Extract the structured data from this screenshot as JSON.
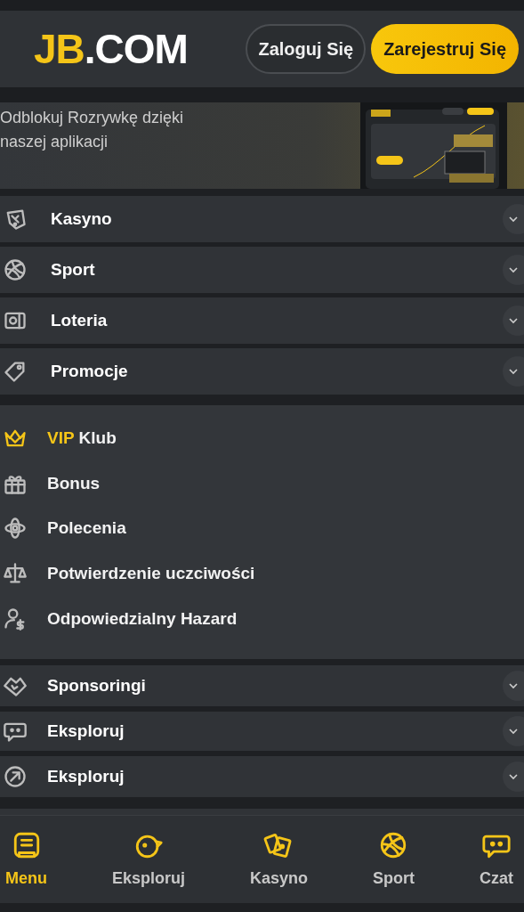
{
  "header": {
    "logo": {
      "accent": "JB",
      "rest": ".COM"
    },
    "login_button": "Zaloguj Się",
    "register_button": "Zarejestruj Się"
  },
  "banner": {
    "text": "Odblokuj Rozrywkę dzięki naszej aplikacji"
  },
  "main_sections": [
    {
      "label": "Kasyno",
      "expanded": false
    },
    {
      "label": "Sport",
      "expanded": false
    },
    {
      "label": "Loteria",
      "expanded": false
    },
    {
      "label": "Promocje",
      "expanded": false
    }
  ],
  "links": [
    {
      "highlight": "VIP",
      "label": "Klub"
    },
    {
      "label": "Bonus"
    },
    {
      "label": "Polecenia"
    },
    {
      "label": "Potwierdzenie uczciwości"
    },
    {
      "label": "Odpowiedzialny Hazard"
    }
  ],
  "more_sections": [
    {
      "label": "Sponsoringi",
      "expanded": false
    },
    {
      "label": "Eksploruj",
      "expanded": false
    },
    {
      "label": "Eksploruj",
      "expanded": false
    }
  ],
  "bottom_nav": [
    {
      "label": "Menu",
      "selected": true
    },
    {
      "label": "Eksploruj",
      "selected": false
    },
    {
      "label": "Kasyno",
      "selected": false
    },
    {
      "label": "Sport",
      "selected": false
    },
    {
      "label": "Czat",
      "selected": false
    }
  ]
}
